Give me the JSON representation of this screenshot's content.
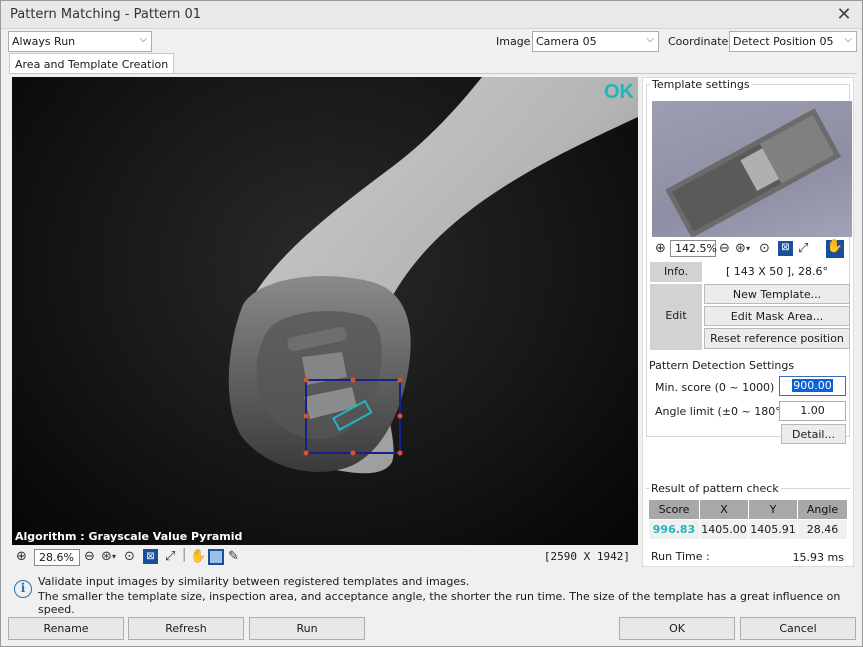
{
  "window": {
    "title": "Pattern Matching - Pattern 01",
    "close_glyph": "✕"
  },
  "toolbar": {
    "run_mode": "Always Run",
    "image_label": "Image",
    "image_value": "Camera 05",
    "coordinate_label": "Coordinate",
    "coordinate_value": "Detect Position 05"
  },
  "tabs": [
    {
      "label": "Area and Template Creation",
      "active": true
    }
  ],
  "viewer": {
    "status": "OK",
    "algorithm": "Algorithm : Grayscale Value Pyramid",
    "zoom": "28.6%",
    "image_size": "[2590 X 1942]"
  },
  "template_settings": {
    "title": "Template settings",
    "zoom": "142.5%",
    "info_label": "Info.",
    "info_value": "[ 143 X 50 ], 28.6°",
    "edit_label": "Edit",
    "new_template": "New Template...",
    "edit_mask": "Edit Mask Area...",
    "reset_reference": "Reset reference position"
  },
  "detection": {
    "title": "Pattern Detection Settings",
    "min_score_label": "Min. score (0 ~ 1000)",
    "min_score": "900.00",
    "angle_label": "Angle limit (±0 ~ 180°)",
    "angle": "1.00",
    "detail_button": "Detail..."
  },
  "result": {
    "title": "Result of pattern check",
    "headers": [
      "Score",
      "X",
      "Y",
      "Angle"
    ],
    "values": [
      "996.83",
      "1405.00",
      "1405.91",
      "28.46"
    ],
    "runtime_label": "Run Time :",
    "runtime_value": "15.93 ms",
    "score_color": "#20b5c3"
  },
  "info": {
    "line1": "Validate input images by similarity between registered templates and images.",
    "line2": "The smaller the template size, inspection area, and acceptance angle, the shorter the run time. The size of the template has a great influence on speed."
  },
  "buttons": {
    "rename": "Rename",
    "refresh": "Refresh",
    "run": "Run",
    "ok": "OK",
    "cancel": "Cancel"
  },
  "colors": {
    "accent": "#1fb5c0",
    "roi_box": "#1a1f8c",
    "roi_handle": "#e0521e",
    "selection": "#0b63d6"
  }
}
